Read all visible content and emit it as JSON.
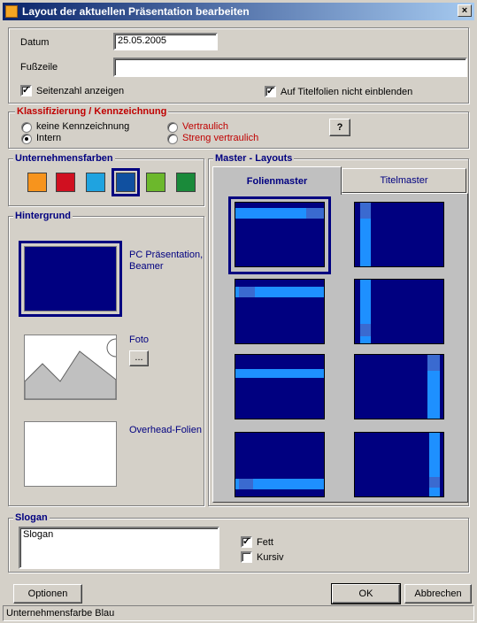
{
  "window": {
    "title": "Layout der aktuellen Präsentation bearbeiten",
    "close": "×"
  },
  "header": {
    "datum_label": "Datum",
    "datum_value": "25.05.2005",
    "fusszeile_label": "Fußzeile",
    "fusszeile_value": "",
    "seitenzahl_label": "Seitenzahl anzeigen",
    "seitenzahl_checked": true,
    "titelfolien_label": "Auf Titelfolien nicht einblenden",
    "titelfolien_checked": true
  },
  "classification": {
    "title": "Klassifizierung / Kennzeichnung",
    "options": [
      {
        "label": "keine Kennzeichnung",
        "checked": false
      },
      {
        "label": "Intern",
        "checked": true
      },
      {
        "label": "Vertraulich",
        "checked": false
      },
      {
        "label": "Streng vertraulich",
        "checked": false
      }
    ],
    "help_label": "?"
  },
  "company_colors": {
    "title": "Unternehmensfarben",
    "swatches": [
      "#f7941d",
      "#d01020",
      "#1fa3e0",
      "#1050a0",
      "#6cb82c",
      "#1a8a3a"
    ],
    "selected_index": 3
  },
  "background": {
    "title": "Hintergrund",
    "options": [
      {
        "label": "PC Präsentation, Beamer",
        "selected": true,
        "color": "#000080"
      },
      {
        "label": "Foto",
        "browse_label": "...",
        "selected": false
      },
      {
        "label": "Overhead-Folien",
        "selected": false,
        "color": "#ffffff"
      }
    ]
  },
  "master_layouts": {
    "title": "Master - Layouts",
    "tabs": [
      {
        "label": "Folienmaster",
        "active": true
      },
      {
        "label": "Titelmaster",
        "active": false
      }
    ],
    "selected_index": 0,
    "layouts": [
      "top-bar",
      "left-bar",
      "top-bar-inset",
      "left-bar-short",
      "top-bar-low",
      "right-bar",
      "bottom-bar",
      "right-bar-low"
    ]
  },
  "slogan": {
    "title": "Slogan",
    "value": "Slogan",
    "fett_label": "Fett",
    "fett_checked": true,
    "kursiv_label": "Kursiv",
    "kursiv_checked": false
  },
  "buttons": {
    "options": "Optionen",
    "ok": "OK",
    "cancel": "Abbrechen"
  },
  "status": "Unternehmensfarbe Blau"
}
